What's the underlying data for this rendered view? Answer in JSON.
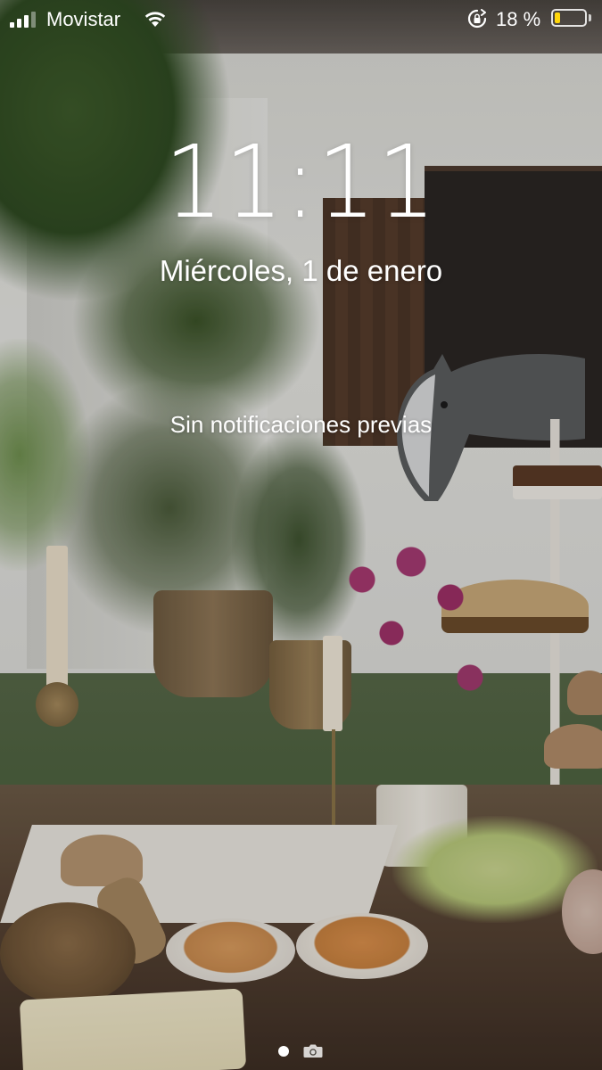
{
  "status_bar": {
    "carrier": "Movistar",
    "signal_bars_active": 3,
    "signal_bars_total": 4,
    "battery_percent_label": "18 %",
    "battery_level": 0.18,
    "icons": [
      "signal-icon",
      "wifi-icon",
      "rotation-lock-icon",
      "battery-icon"
    ]
  },
  "lock_screen": {
    "time": "11:11",
    "date": "Miércoles, 1 de enero",
    "notifications_message": "Sin notificaciones previas"
  },
  "pager": {
    "pages": [
      "dot",
      "camera-icon"
    ],
    "active_page": 0
  },
  "colors": {
    "battery_low": "#ffd60a",
    "text": "#ffffff"
  }
}
